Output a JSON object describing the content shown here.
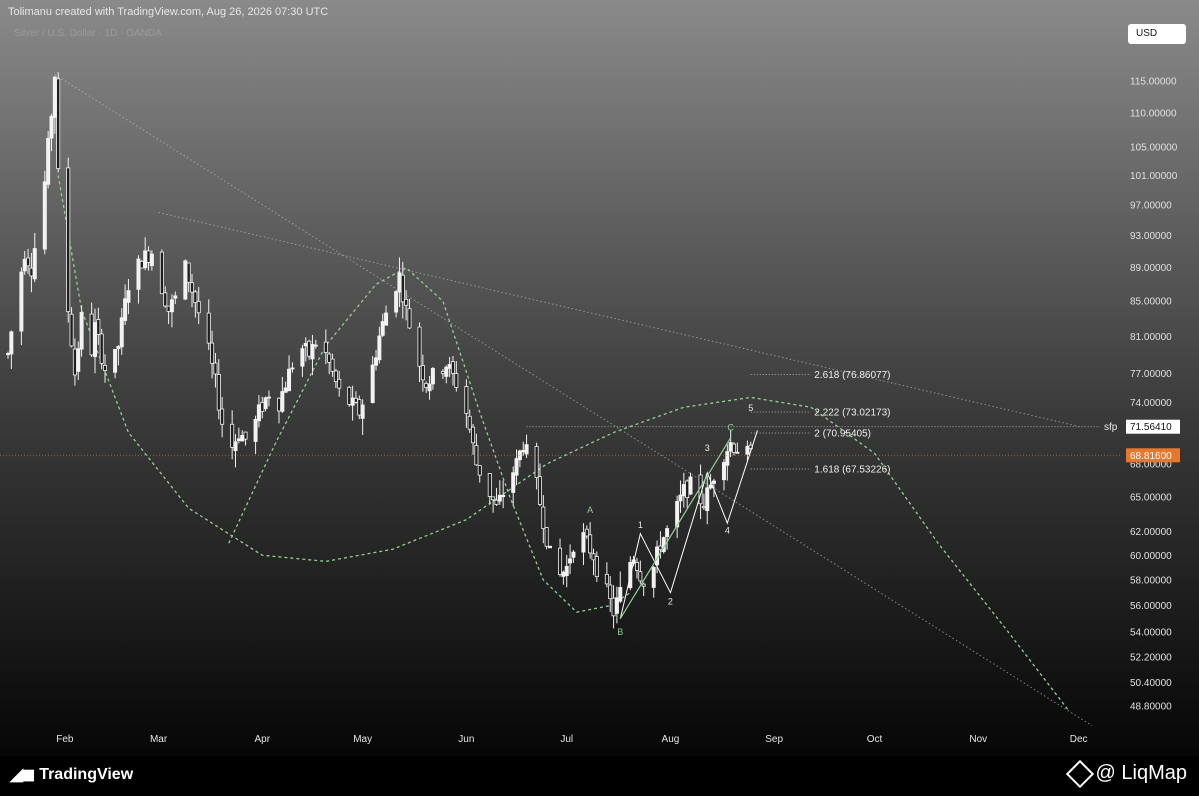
{
  "header": {
    "credit": "Tolimanu created with TradingView.com, Aug 26, 2026 07:30 UTC",
    "symbol": "Silver / U.S. Dollar · 1D · OANDA",
    "currency_button": "USD"
  },
  "footer": {
    "brand_left": "TradingView",
    "brand_right": "@ LiqMap"
  },
  "colors": {
    "background_top": "#888888",
    "background_bottom": "#050505",
    "candle": "#f2f2f2",
    "wave_green": "#8fd18f",
    "current_price_badge": "#e8772e",
    "trendline": "#bdbdbd"
  },
  "chart_data": {
    "type": "candlestick",
    "title": "Silver / U.S. Dollar · 1D · OANDA",
    "y_scale": "log",
    "ylim": [
      48,
      118
    ],
    "x_range": [
      "2026-01-15",
      "2026-12-05"
    ],
    "grid": false,
    "x_ticks": [
      {
        "label": "Feb",
        "date": "2026-02-01"
      },
      {
        "label": "Mar",
        "date": "2026-03-01"
      },
      {
        "label": "Apr",
        "date": "2026-04-01"
      },
      {
        "label": "May",
        "date": "2026-05-01"
      },
      {
        "label": "Jun",
        "date": "2026-06-01"
      },
      {
        "label": "Jul",
        "date": "2026-07-01"
      },
      {
        "label": "Aug",
        "date": "2026-08-01"
      },
      {
        "label": "Sep",
        "date": "2026-09-01"
      },
      {
        "label": "Oct",
        "date": "2026-10-01"
      },
      {
        "label": "Nov",
        "date": "2026-11-01"
      },
      {
        "label": "Dec",
        "date": "2026-12-01"
      }
    ],
    "y_ticks": [
      {
        "value": 115,
        "label": "115.00000"
      },
      {
        "value": 110,
        "label": "110.00000"
      },
      {
        "value": 105,
        "label": "105.00000"
      },
      {
        "value": 101,
        "label": "101.00000"
      },
      {
        "value": 97,
        "label": "97.00000"
      },
      {
        "value": 93,
        "label": "93.00000"
      },
      {
        "value": 89,
        "label": "89.00000"
      },
      {
        "value": 85,
        "label": "85.00000"
      },
      {
        "value": 81,
        "label": "81.00000"
      },
      {
        "value": 77,
        "label": "77.00000"
      },
      {
        "value": 74,
        "label": "74.00000"
      },
      {
        "value": 68,
        "label": "68.00000"
      },
      {
        "value": 65,
        "label": "65.00000"
      },
      {
        "value": 62,
        "label": "62.00000"
      },
      {
        "value": 60,
        "label": "60.00000"
      },
      {
        "value": 58,
        "label": "58.00000"
      },
      {
        "value": 56,
        "label": "56.00000"
      },
      {
        "value": 54,
        "label": "54.00000"
      },
      {
        "value": 52.2,
        "label": "52.20000"
      },
      {
        "value": 50.4,
        "label": "50.40000"
      },
      {
        "value": 48.8,
        "label": "48.80000"
      }
    ],
    "price_path": [
      {
        "date": "2026-01-15",
        "price": 79
      },
      {
        "date": "2026-01-17",
        "price": 84
      },
      {
        "date": "2026-01-20",
        "price": 91
      },
      {
        "date": "2026-01-22",
        "price": 89
      },
      {
        "date": "2026-01-24",
        "price": 94
      },
      {
        "date": "2026-01-26",
        "price": 100
      },
      {
        "date": "2026-01-28",
        "price": 110
      },
      {
        "date": "2026-01-29",
        "price": 116
      },
      {
        "date": "2026-01-30",
        "price": 101
      },
      {
        "date": "2026-01-31",
        "price": 80
      },
      {
        "date": "2026-02-02",
        "price": 84
      },
      {
        "date": "2026-02-04",
        "price": 77
      },
      {
        "date": "2026-02-06",
        "price": 83
      },
      {
        "date": "2026-02-08",
        "price": 77
      },
      {
        "date": "2026-02-10",
        "price": 82
      },
      {
        "date": "2026-02-14",
        "price": 76
      },
      {
        "date": "2026-02-17",
        "price": 80
      },
      {
        "date": "2026-02-20",
        "price": 87
      },
      {
        "date": "2026-02-24",
        "price": 90
      },
      {
        "date": "2026-02-27",
        "price": 91
      },
      {
        "date": "2026-03-01",
        "price": 88
      },
      {
        "date": "2026-03-04",
        "price": 84
      },
      {
        "date": "2026-03-07",
        "price": 86
      },
      {
        "date": "2026-03-09",
        "price": 89
      },
      {
        "date": "2026-03-12",
        "price": 85
      },
      {
        "date": "2026-03-15",
        "price": 81
      },
      {
        "date": "2026-03-18",
        "price": 76
      },
      {
        "date": "2026-03-20",
        "price": 72
      },
      {
        "date": "2026-03-22",
        "price": 69
      },
      {
        "date": "2026-03-25",
        "price": 71
      },
      {
        "date": "2026-03-28",
        "price": 70
      },
      {
        "date": "2026-03-31",
        "price": 73
      },
      {
        "date": "2026-04-03",
        "price": 75
      },
      {
        "date": "2026-04-06",
        "price": 74
      },
      {
        "date": "2026-04-09",
        "price": 77
      },
      {
        "date": "2026-04-12",
        "price": 80
      },
      {
        "date": "2026-04-15",
        "price": 79
      },
      {
        "date": "2026-04-18",
        "price": 81
      },
      {
        "date": "2026-04-21",
        "price": 78
      },
      {
        "date": "2026-04-24",
        "price": 75
      },
      {
        "date": "2026-04-27",
        "price": 74
      },
      {
        "date": "2026-04-30",
        "price": 73
      },
      {
        "date": "2026-05-03",
        "price": 76
      },
      {
        "date": "2026-05-06",
        "price": 81
      },
      {
        "date": "2026-05-09",
        "price": 85
      },
      {
        "date": "2026-05-12",
        "price": 88
      },
      {
        "date": "2026-05-14",
        "price": 84
      },
      {
        "date": "2026-05-17",
        "price": 79
      },
      {
        "date": "2026-05-20",
        "price": 76
      },
      {
        "date": "2026-05-23",
        "price": 77
      },
      {
        "date": "2026-05-26",
        "price": 78
      },
      {
        "date": "2026-05-29",
        "price": 76
      },
      {
        "date": "2026-06-01",
        "price": 73
      },
      {
        "date": "2026-06-04",
        "price": 68
      },
      {
        "date": "2026-06-07",
        "price": 66
      },
      {
        "date": "2026-06-10",
        "price": 64
      },
      {
        "date": "2026-06-13",
        "price": 66
      },
      {
        "date": "2026-06-16",
        "price": 68
      },
      {
        "date": "2026-06-18",
        "price": 70
      },
      {
        "date": "2026-06-20",
        "price": 68
      },
      {
        "date": "2026-06-22",
        "price": 66
      },
      {
        "date": "2026-06-24",
        "price": 63
      },
      {
        "date": "2026-06-26",
        "price": 60
      },
      {
        "date": "2026-06-28",
        "price": 58
      },
      {
        "date": "2026-07-01",
        "price": 59
      },
      {
        "date": "2026-07-03",
        "price": 61
      },
      {
        "date": "2026-07-05",
        "price": 62
      },
      {
        "date": "2026-07-07",
        "price": 61
      },
      {
        "date": "2026-07-09",
        "price": 60
      },
      {
        "date": "2026-07-11",
        "price": 58
      },
      {
        "date": "2026-07-13",
        "price": 57
      },
      {
        "date": "2026-07-15",
        "price": 55.5
      },
      {
        "date": "2026-07-17",
        "price": 57
      },
      {
        "date": "2026-07-19",
        "price": 59
      },
      {
        "date": "2026-07-21",
        "price": 60
      },
      {
        "date": "2026-07-23",
        "price": 58.5
      },
      {
        "date": "2026-07-25",
        "price": 57.5
      },
      {
        "date": "2026-07-27",
        "price": 59
      },
      {
        "date": "2026-07-29",
        "price": 61
      },
      {
        "date": "2026-07-31",
        "price": 62
      },
      {
        "date": "2026-08-03",
        "price": 64
      },
      {
        "date": "2026-08-05",
        "price": 65.5
      },
      {
        "date": "2026-08-07",
        "price": 66
      },
      {
        "date": "2026-08-09",
        "price": 65
      },
      {
        "date": "2026-08-11",
        "price": 64.5
      },
      {
        "date": "2026-08-13",
        "price": 66
      },
      {
        "date": "2026-08-15",
        "price": 68
      },
      {
        "date": "2026-08-17",
        "price": 69
      },
      {
        "date": "2026-08-19",
        "price": 70
      },
      {
        "date": "2026-08-21",
        "price": 69.5
      },
      {
        "date": "2026-08-23",
        "price": 69
      },
      {
        "date": "2026-08-25",
        "price": 68.8
      }
    ],
    "current_price": {
      "value": 68.816,
      "label": "68.81600"
    },
    "sfp_level": {
      "value": 71.5641,
      "label": "71.56410",
      "tag": "sfp"
    },
    "fib_extensions": [
      {
        "ratio_label": "2.618 (76.86077)",
        "value": 76.86077
      },
      {
        "ratio_label": "2.222 (73.02173)",
        "value": 73.02173
      },
      {
        "ratio_label": "2 (70.95405)",
        "value": 70.95405
      },
      {
        "ratio_label": "1.618 (67.53226)",
        "value": 67.53226
      }
    ],
    "wave_labels": [
      {
        "text": "A",
        "date": "2026-07-08",
        "price": 63.6
      },
      {
        "text": "B",
        "date": "2026-07-17",
        "price": 53.8
      },
      {
        "text": "C",
        "date": "2026-08-19",
        "price": 71.2
      },
      {
        "text": "1",
        "date": "2026-07-23",
        "price": 62.3
      },
      {
        "text": "2",
        "date": "2026-08-01",
        "price": 56.1
      },
      {
        "text": "3",
        "date": "2026-08-12",
        "price": 69.2
      },
      {
        "text": "4",
        "date": "2026-08-18",
        "price": 61.8
      },
      {
        "text": "5",
        "date": "2026-08-25",
        "price": 73.1
      }
    ]
  }
}
